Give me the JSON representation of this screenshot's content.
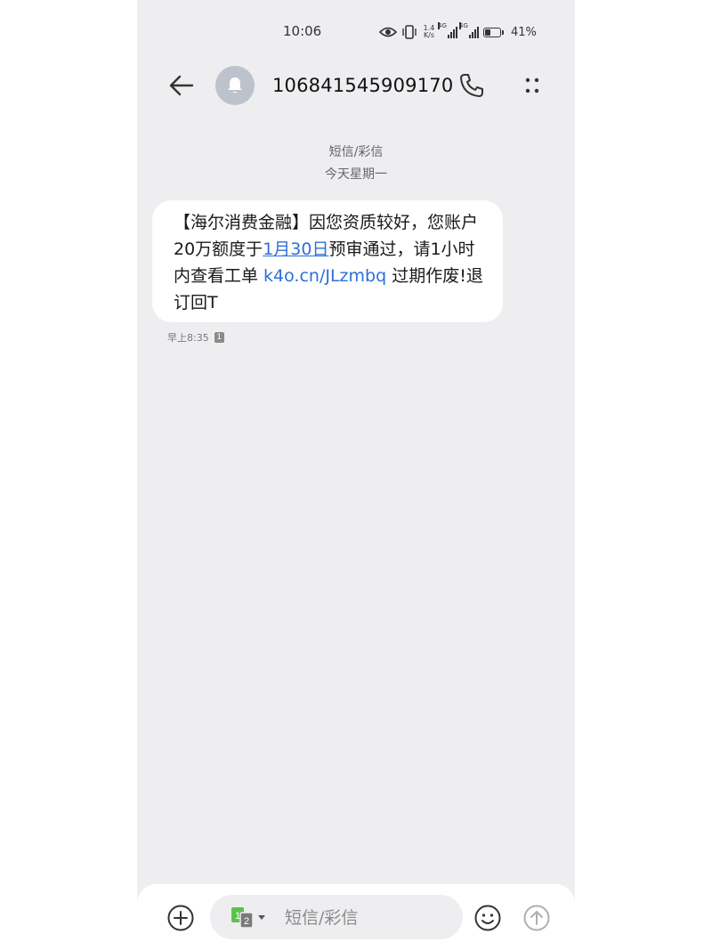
{
  "status_bar": {
    "time": "10:06",
    "net_speed_value": "1.4",
    "net_speed_unit": "K/s",
    "sim1_label": "4G",
    "sim2_label": "4G",
    "battery_percent": "41%",
    "battery_level": 0.41
  },
  "header": {
    "sender": "106841545909170",
    "avatar_icon": "bell-icon"
  },
  "conversation": {
    "message_type": "短信/彩信",
    "day_label": "今天星期一"
  },
  "message": {
    "text_part1": "【海尔消费金融】因您资质较好，您账户20万额度于",
    "date_link": "1月30日",
    "text_part2": "预审通过，请1小时内查看工单 ",
    "url_link": "k4o.cn/JLzmbq",
    "text_part3": " 过期作废!退订回T",
    "time": "早上8:35",
    "sim_badge": "1"
  },
  "composer": {
    "sim_primary": "1",
    "sim_secondary": "2",
    "placeholder": "短信/彩信"
  },
  "colors": {
    "background": "#eeeef1",
    "bubble": "#ffffff",
    "link": "#2d6fd8",
    "sim_green": "#5cc24a"
  }
}
